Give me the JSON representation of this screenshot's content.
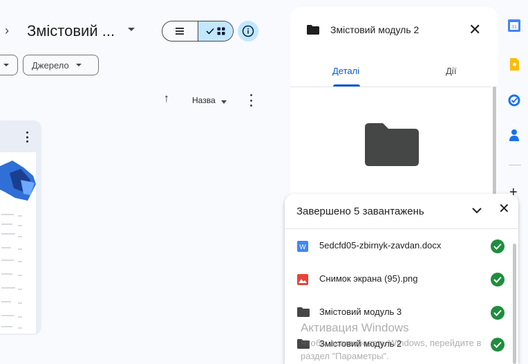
{
  "header": {
    "folder_title": "Змістовий ...",
    "chip_source": "Джерело",
    "sort_label": "Назва"
  },
  "details_panel": {
    "title": "Змістовий модуль 2",
    "tab_details": "Деталі",
    "tab_actions": "Дії"
  },
  "uploads": {
    "title": "Завершено 5 завантажень",
    "items": [
      {
        "name": "5edcfd05-zbirnyk-zavdan.docx",
        "icon": "word-doc-icon"
      },
      {
        "name": "Снимок экрана (95).png",
        "icon": "image-file-icon"
      },
      {
        "name": "Змістовий модуль 3",
        "icon": "folder-icon"
      },
      {
        "name": "Змістовий модуль 2",
        "icon": "folder-icon"
      }
    ]
  },
  "watermark": {
    "line1": "Активация Windows",
    "line2": "Чтобы активировать Windows, перейдите в",
    "line3": "раздел \"Параметры\"."
  },
  "rail": {
    "calendar_day": "31",
    "icons": [
      "calendar-icon",
      "keep-icon",
      "tasks-icon",
      "contacts-icon",
      "add-icon"
    ]
  },
  "colors": {
    "accent": "#0b57d0",
    "toggle_active": "#c2e7ff",
    "success": "#1e8e3e",
    "folder": "#444746"
  }
}
